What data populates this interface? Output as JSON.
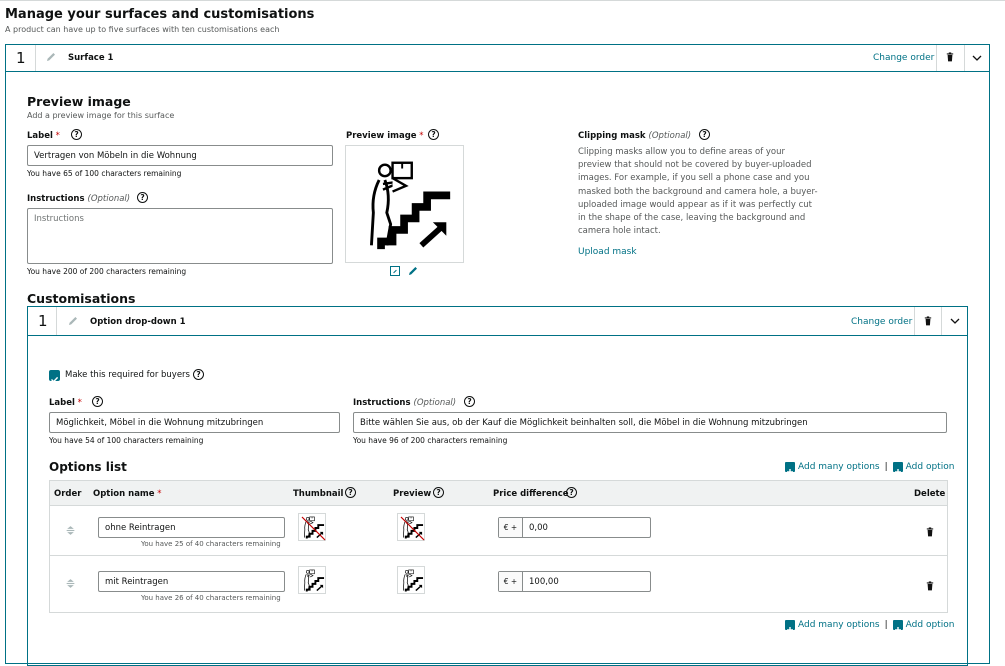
{
  "header": {
    "title": "Manage your surfaces and customisations",
    "subtitle": "A product can have up to five surfaces with ten customisations each"
  },
  "surface": {
    "number": "1",
    "name": "Surface 1",
    "change_order": "Change order"
  },
  "preview_section": {
    "title": "Preview image",
    "subtitle": "Add a preview image for this surface",
    "label_label": "Label",
    "label_value": "Vertragen von Möbeln in die Wohnung",
    "label_remaining": "You have 65 of 100 characters remaining",
    "instructions_label": "Instructions",
    "optional": "(Optional)",
    "instructions_placeholder": "Instructions",
    "instructions_remaining": "You have 200 of 200 characters remaining",
    "preview_image_label": "Preview image",
    "clipping_label": "Clipping mask",
    "clipping_text": "Clipping masks allow you to define areas of your preview that should not be covered by buyer-uploaded images. For example, if you sell a phone case and you masked both the background and camera hole, a buyer-uploaded image would appear as if it was perfectly cut in the shape of the case, leaving the background and camera hole intact.",
    "upload_mask": "Upload mask"
  },
  "customisations": {
    "title": "Customisations",
    "number": "1",
    "name": "Option drop-down 1",
    "change_order": "Change order",
    "required_label": "Make this required for buyers",
    "label_label": "Label",
    "label_value": "Möglichkeit, Möbel in die Wohnung mitzubringen",
    "label_remaining": "You have 54 of 100 characters remaining",
    "instructions_label": "Instructions",
    "optional": "(Optional)",
    "instructions_value": "Bitte wählen Sie aus, ob der Kauf die Möglichkeit beinhalten soll, die Möbel in die Wohnung mitzubringen",
    "instructions_remaining": "You have 96 of 200 characters remaining"
  },
  "options_list": {
    "title": "Options list",
    "add_many": "Add many options",
    "separator": "|",
    "add_option": "Add option",
    "columns": {
      "order": "Order",
      "option_name": "Option name",
      "thumbnail": "Thumbnail",
      "preview": "Preview",
      "price_difference": "Price difference",
      "delete": "Delete"
    },
    "currency": "€ +",
    "rows": [
      {
        "name": "ohne Reintragen",
        "remaining": "You have 25 of 40 characters remaining",
        "price": "0,00",
        "crossed": true
      },
      {
        "name": "mit Reintragen",
        "remaining": "You have 26 of 40 characters remaining",
        "price": "100,00",
        "crossed": false
      }
    ]
  },
  "colors": {
    "accent": "#007185",
    "required": "#c40000"
  },
  "icons": [
    "pencil-icon",
    "trash-icon",
    "chevron-down-icon",
    "help-icon",
    "expand-icon",
    "edit-icon",
    "checkbox-checked-icon",
    "drag-handle-icon",
    "add-box-icon",
    "mover-stairs-icon"
  ]
}
